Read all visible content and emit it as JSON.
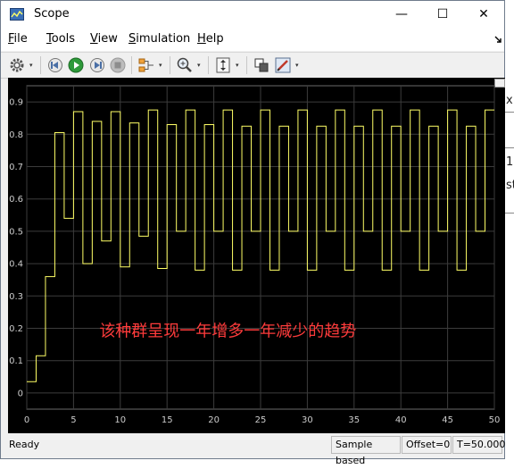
{
  "window": {
    "title": "Scope",
    "minimize_glyph": "—",
    "maximize_glyph": "☐",
    "close_glyph": "✕"
  },
  "menu": [
    {
      "key": "F",
      "rest": "ile"
    },
    {
      "key": "T",
      "rest": "ools"
    },
    {
      "key": "V",
      "rest": "iew"
    },
    {
      "key": "S",
      "rest": "imulation"
    },
    {
      "key": "H",
      "rest": "elp"
    }
  ],
  "toolbar": {
    "icons": [
      "gear-icon",
      "step-back-icon",
      "run-icon",
      "step-forward-icon",
      "stop-icon",
      "signal-selector-icon",
      "zoom-icon",
      "autoscale-icon",
      "highlight-icon",
      "style-icon"
    ],
    "dropdown_glyph": "▾"
  },
  "status": {
    "left": "Ready",
    "mode": "Sample based",
    "offset": "Offset=0",
    "time": "T=50.000"
  },
  "background_fragments": [
    "x",
    "1",
    "st"
  ],
  "chart_data": {
    "type": "line",
    "style": "step",
    "x": [
      0,
      1,
      2,
      3,
      4,
      5,
      6,
      7,
      8,
      9,
      10,
      11,
      12,
      13,
      14,
      15,
      16,
      17,
      18,
      19,
      20,
      21,
      22,
      23,
      24,
      25,
      26,
      27,
      28,
      29,
      30,
      31,
      32,
      33,
      34,
      35,
      36,
      37,
      38,
      39,
      40,
      41,
      42,
      43,
      44,
      45,
      46,
      47,
      48,
      49,
      50
    ],
    "series": [
      {
        "values": [
          0.035,
          0.115,
          0.36,
          0.805,
          0.54,
          0.87,
          0.4,
          0.84,
          0.47,
          0.87,
          0.39,
          0.835,
          0.485,
          0.875,
          0.385,
          0.83,
          0.5,
          0.875,
          0.38,
          0.83,
          0.5,
          0.875,
          0.38,
          0.825,
          0.5,
          0.875,
          0.38,
          0.825,
          0.5,
          0.875,
          0.38,
          0.825,
          0.5,
          0.875,
          0.38,
          0.825,
          0.5,
          0.875,
          0.38,
          0.825,
          0.5,
          0.875,
          0.38,
          0.825,
          0.5,
          0.875,
          0.38,
          0.825,
          0.5,
          0.875,
          0.875
        ]
      }
    ],
    "xlim": [
      0,
      50
    ],
    "ylim": [
      -0.05,
      0.95
    ],
    "xticks": [
      "0",
      "5",
      "10",
      "15",
      "20",
      "25",
      "30",
      "35",
      "40",
      "45",
      "50"
    ],
    "yticks": [
      "0",
      "0.1",
      "0.2",
      "0.3",
      "0.4",
      "0.5",
      "0.6",
      "0.7",
      "0.8",
      "0.9"
    ],
    "grid": true,
    "annotation": "该种群呈现一年增多一年减少的趋势",
    "colors": {
      "background": "#000000",
      "line": "#ffff66",
      "grid": "#3c3c3c",
      "text": "#cccccc",
      "annotation": "#ff3b3b"
    }
  }
}
